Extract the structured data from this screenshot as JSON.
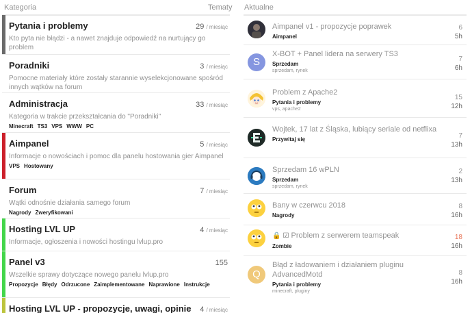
{
  "headers": {
    "category": "Kategoria",
    "topics": "Tematy",
    "latest": "Aktualne"
  },
  "categories": [
    {
      "name": "Pytania i problemy",
      "desc": "Kto pyta nie błądzi - a nawet znajduje odpowiedź na nurtujący go problem",
      "count": "29",
      "per": "/ miesiąc",
      "color": "#6a6a6a",
      "subs": []
    },
    {
      "name": "Poradniki",
      "desc": "Pomocne materiały które zostały starannie wyselekcjonowane spośród innych wątków na forum",
      "count": "3",
      "per": "/ miesiąc",
      "color": "#ffffff",
      "subs": []
    },
    {
      "name": "Administracja",
      "desc": "Kategoria w trakcie przekształcania do \"Poradniki\"",
      "count": "33",
      "per": "/ miesiąc",
      "color": "#ffffff",
      "subs": [
        "Minecraft",
        "TS3",
        "VPS",
        "WWW",
        "PC"
      ]
    },
    {
      "name": "Aimpanel",
      "desc": "Informacje o nowościach i pomoc dla panelu hostowania gier Aimpanel",
      "count": "5",
      "per": "/ miesiąc",
      "color": "#cc1f2a",
      "subs": [
        "VPS",
        "Hostowany"
      ]
    },
    {
      "name": "Forum",
      "desc": "Wątki odnośnie działania samego forum",
      "count": "7",
      "per": "/ miesiąc",
      "color": "#ffffff",
      "subs": [
        "Nagrody",
        "Zweryfikowani"
      ]
    },
    {
      "name": "Hosting LVL UP",
      "desc": "Informacje, ogłoszenia i nowości hostingu lvlup.pro",
      "count": "4",
      "per": "/ miesiąc",
      "color": "#43d64a",
      "subs": []
    },
    {
      "name": "Panel v3",
      "desc": "Wszelkie sprawy dotyczące nowego panelu lvlup.pro",
      "count": "155",
      "per": "",
      "color": "#43d64a",
      "subs": [
        "Propozycje",
        "Błędy",
        "Odrzucone",
        "Zaimplementowane",
        "Naprawione",
        "Instrukcje"
      ]
    },
    {
      "name": "Hosting LVL UP - propozycje, uwagi, opinie",
      "desc": "",
      "count": "4",
      "per": "/ miesiąc",
      "color": "#bcc43d",
      "subs": []
    }
  ],
  "topics": [
    {
      "title": "Aimpanel v1 - propozycje poprawek",
      "category": "Aimpanel",
      "tags": "",
      "posts": "6",
      "age": "5h",
      "avatar": "photo-dark",
      "hot": false,
      "locked": false
    },
    {
      "title": "X-BOT + Panel lidera na serwery TS3",
      "category": "Sprzedam",
      "tags": "sprzedam, rynek",
      "posts": "7",
      "age": "6h",
      "avatar": "letter-s",
      "letter": "S",
      "hot": false,
      "locked": false
    },
    {
      "title": "Problem z Apache2",
      "category": "Pytania i problemy",
      "tags": "vps, apache2",
      "posts": "15",
      "age": "12h",
      "avatar": "anime-face",
      "hot": false,
      "locked": false
    },
    {
      "title": "Wojtek, 17 lat z Śląska, lubiący seriale od netflixa",
      "category": "Przywitaj się",
      "tags": "",
      "posts": "7",
      "age": "13h",
      "avatar": "e-logo",
      "hot": false,
      "locked": false
    },
    {
      "title": "Sprzedam 16 wPLN",
      "category": "Sprzedam",
      "tags": "sprzedam, rynek",
      "posts": "2",
      "age": "13h",
      "avatar": "headset-logo",
      "hot": false,
      "locked": false
    },
    {
      "title": "Bany w czerwcu 2018",
      "category": "Nagrody",
      "tags": "",
      "posts": "8",
      "age": "16h",
      "avatar": "emoji-eyes",
      "hot": false,
      "locked": false
    },
    {
      "title": "Problem z serwerem teamspeak",
      "category": "Zombie",
      "tags": "",
      "posts": "18",
      "age": "16h",
      "avatar": "emoji-eyes",
      "hot": true,
      "locked": true
    },
    {
      "title": "Błąd z ładowaniem i działaniem pluginu AdvancedMotd",
      "category": "Pytania i problemy",
      "tags": "minecraft, pluginy",
      "posts": "8",
      "age": "16h",
      "avatar": "letter-q",
      "letter": "Q",
      "hot": false,
      "locked": false
    }
  ]
}
